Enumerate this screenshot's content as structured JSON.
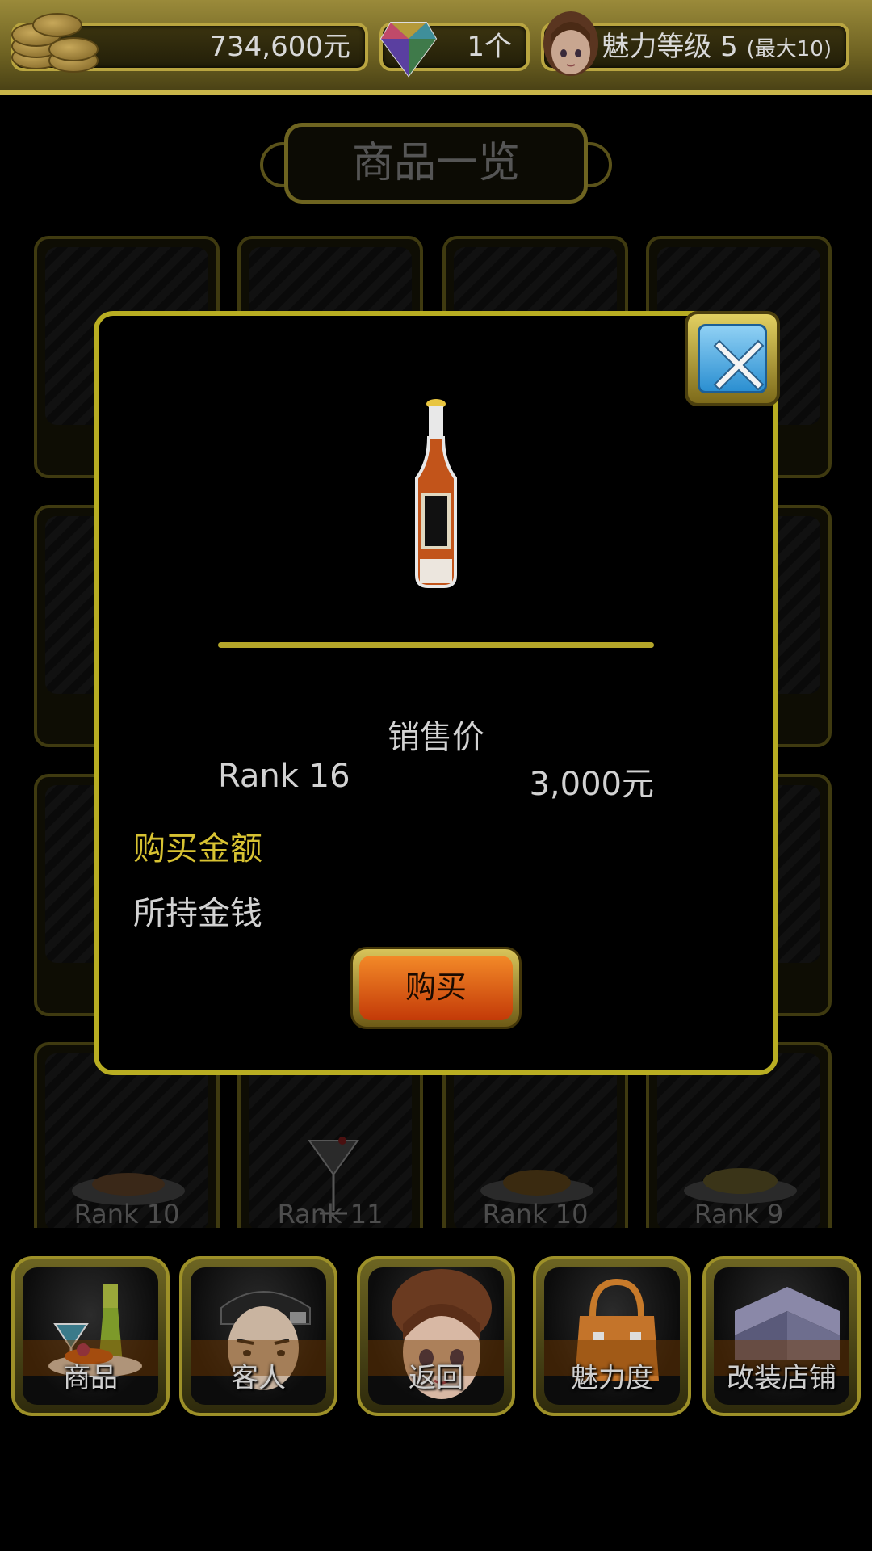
{
  "topbar": {
    "money": "734,600元",
    "gems": "1个",
    "charm_label": "魅力等级 5",
    "charm_max": "(最大10)"
  },
  "shop": {
    "title": "商品一览",
    "background_cards": [
      {
        "rank": "Rank 10"
      },
      {
        "rank": "Rank 11"
      },
      {
        "rank": "Rank 10"
      },
      {
        "rank": "Rank 9"
      }
    ]
  },
  "dialog": {
    "price_heading": "销售价",
    "rank": "Rank 16",
    "price": "3,000元",
    "purchase_amount_label": "购买金额",
    "owned_money_label": "所持金钱",
    "buy_label": "购买",
    "close_icon": "close-icon"
  },
  "nav": {
    "items": [
      {
        "label": "商品",
        "icon": "goods-icon"
      },
      {
        "label": "客人",
        "icon": "guest-icon"
      },
      {
        "label": "返回",
        "icon": "hostess-icon"
      },
      {
        "label": "魅力度",
        "icon": "handbag-icon"
      },
      {
        "label": "改装店铺",
        "icon": "shop-renovate-icon"
      }
    ]
  },
  "colors": {
    "gold_border": "#b8ad22",
    "purchase_label": "#d7c232",
    "buy_button": "#e06018",
    "close_button": "#2b8fd1"
  }
}
